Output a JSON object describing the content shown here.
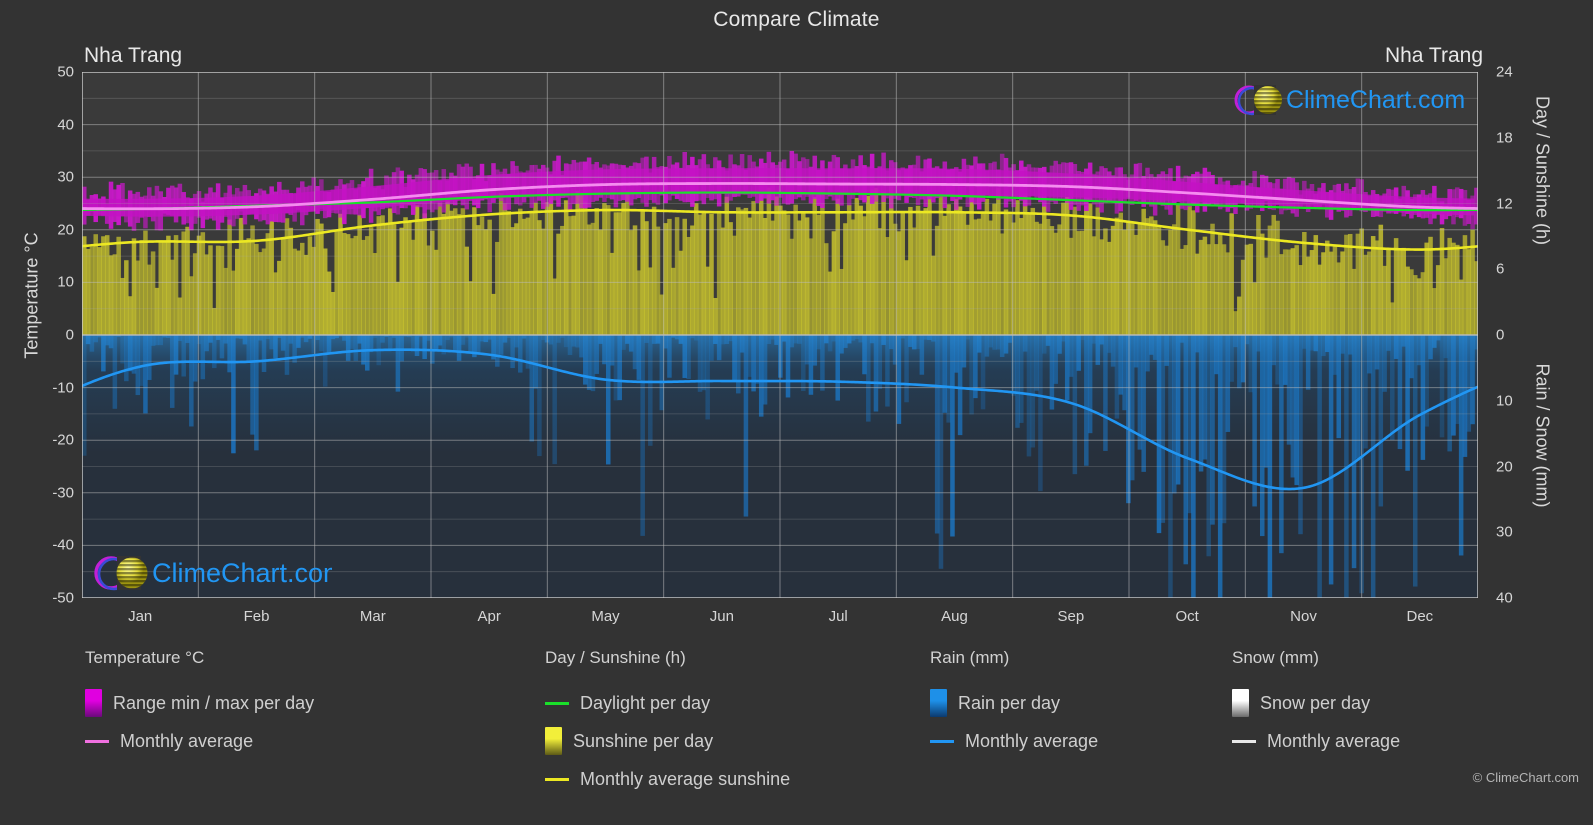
{
  "header": {
    "title": "Compare Climate",
    "location_left": "Nha Trang",
    "location_right": "Nha Trang"
  },
  "watermark": {
    "text": "ClimeChart.com",
    "copyright": "© ClimeChart.com",
    "ring_color": "#c020d8",
    "ring_color2": "#3a4bd8",
    "sphere_color": "#e8e04a",
    "text_color": "#2196f3"
  },
  "axes": {
    "left_title": "Temperature °C",
    "right_title_top": "Day / Sunshine (h)",
    "right_title_bottom": "Rain / Snow (mm)",
    "temp_ticks": [
      50,
      40,
      30,
      20,
      10,
      0,
      -10,
      -20,
      -30,
      -40,
      -50
    ],
    "temp_min": -50,
    "temp_max": 50,
    "sun_ticks": [
      24,
      18,
      12,
      6,
      0
    ],
    "rain_ticks": [
      0,
      10,
      20,
      30,
      40
    ],
    "months": [
      "Jan",
      "Feb",
      "Mar",
      "Apr",
      "May",
      "Jun",
      "Jul",
      "Aug",
      "Sep",
      "Oct",
      "Nov",
      "Dec"
    ]
  },
  "legend": {
    "columns": [
      {
        "heading": "Temperature °C",
        "x": 85,
        "entries": [
          {
            "label": "Range min / max per day",
            "swatch": "box",
            "color": "#e000e0",
            "color2": "#6a0a7a"
          },
          {
            "label": "Monthly average",
            "swatch": "line",
            "color": "#f070e0",
            "color2": "#f070e0"
          }
        ]
      },
      {
        "heading": "Day / Sunshine (h)",
        "x": 545,
        "entries": [
          {
            "label": "Daylight per day",
            "swatch": "line",
            "color": "#1ae02a",
            "color2": "#1ae02a"
          },
          {
            "label": "Sunshine per day",
            "swatch": "box",
            "color": "#f2ef3a",
            "color2": "#5d5a16"
          },
          {
            "label": "Monthly average sunshine",
            "swatch": "line",
            "color": "#ece822",
            "color2": "#ece822"
          }
        ]
      },
      {
        "heading": "Rain (mm)",
        "x": 930,
        "entries": [
          {
            "label": "Rain per day",
            "swatch": "box",
            "color": "#1e90e8",
            "color2": "#0c3a6e"
          },
          {
            "label": "Monthly average",
            "swatch": "line",
            "color": "#2196f3",
            "color2": "#2196f3"
          }
        ]
      },
      {
        "heading": "Snow (mm)",
        "x": 1232,
        "entries": [
          {
            "label": "Snow per day",
            "swatch": "box",
            "color": "#ffffff",
            "color2": "#6a6a6a"
          },
          {
            "label": "Monthly average",
            "swatch": "line",
            "color": "#e8e8e8",
            "color2": "#e8e8e8"
          }
        ]
      }
    ]
  },
  "chart_data": {
    "type": "area",
    "title": "Compare Climate",
    "subtitle": "Nha Trang",
    "xlabel": "",
    "ylabel": "Temperature °C",
    "ylim": [
      -50,
      50
    ],
    "grid": true,
    "legend_position": "bottom",
    "categories": [
      "Jan",
      "Feb",
      "Mar",
      "Apr",
      "May",
      "Jun",
      "Jul",
      "Aug",
      "Sep",
      "Oct",
      "Nov",
      "Dec"
    ],
    "series": [
      {
        "name": "Monthly average temperature",
        "unit": "°C",
        "color": "#f070e0",
        "values": [
          24.0,
          24.4,
          25.8,
          27.6,
          28.6,
          28.8,
          28.7,
          28.6,
          28.2,
          27.0,
          25.6,
          24.3
        ]
      },
      {
        "name": "Daily max temperature (range top)",
        "unit": "°C",
        "color": "#e000e0",
        "values": [
          27.0,
          27.6,
          29.4,
          31.5,
          32.6,
          32.8,
          32.8,
          32.7,
          31.8,
          30.2,
          28.6,
          27.3
        ]
      },
      {
        "name": "Daily min temperature (range bottom)",
        "unit": "°C",
        "color": "#9a0a9a",
        "values": [
          21.4,
          21.8,
          23.1,
          24.8,
          25.6,
          25.7,
          25.5,
          25.4,
          25.1,
          24.3,
          23.3,
          22.0
        ]
      },
      {
        "name": "Daylight per day",
        "unit": "h",
        "color": "#1ae02a",
        "values": [
          11.5,
          11.8,
          12.1,
          12.6,
          12.9,
          13.0,
          12.9,
          12.7,
          12.3,
          11.9,
          11.6,
          11.4
        ]
      },
      {
        "name": "Monthly average sunshine",
        "unit": "h",
        "color": "#ece822",
        "values": [
          8.5,
          8.6,
          10.0,
          11.0,
          11.4,
          11.2,
          11.2,
          11.2,
          10.9,
          9.6,
          8.4,
          7.8
        ]
      },
      {
        "name": "Monthly average rain",
        "unit": "mm",
        "color": "#2196f3",
        "values": [
          4.8,
          4.0,
          2.3,
          3.0,
          6.8,
          7.0,
          7.1,
          8.0,
          10.4,
          18.8,
          23.2,
          12.0
        ]
      },
      {
        "name": "Monthly average snow",
        "unit": "mm",
        "color": "#e8e8e8",
        "values": [
          0,
          0,
          0,
          0,
          0,
          0,
          0,
          0,
          0,
          0,
          0,
          0
        ]
      }
    ]
  }
}
